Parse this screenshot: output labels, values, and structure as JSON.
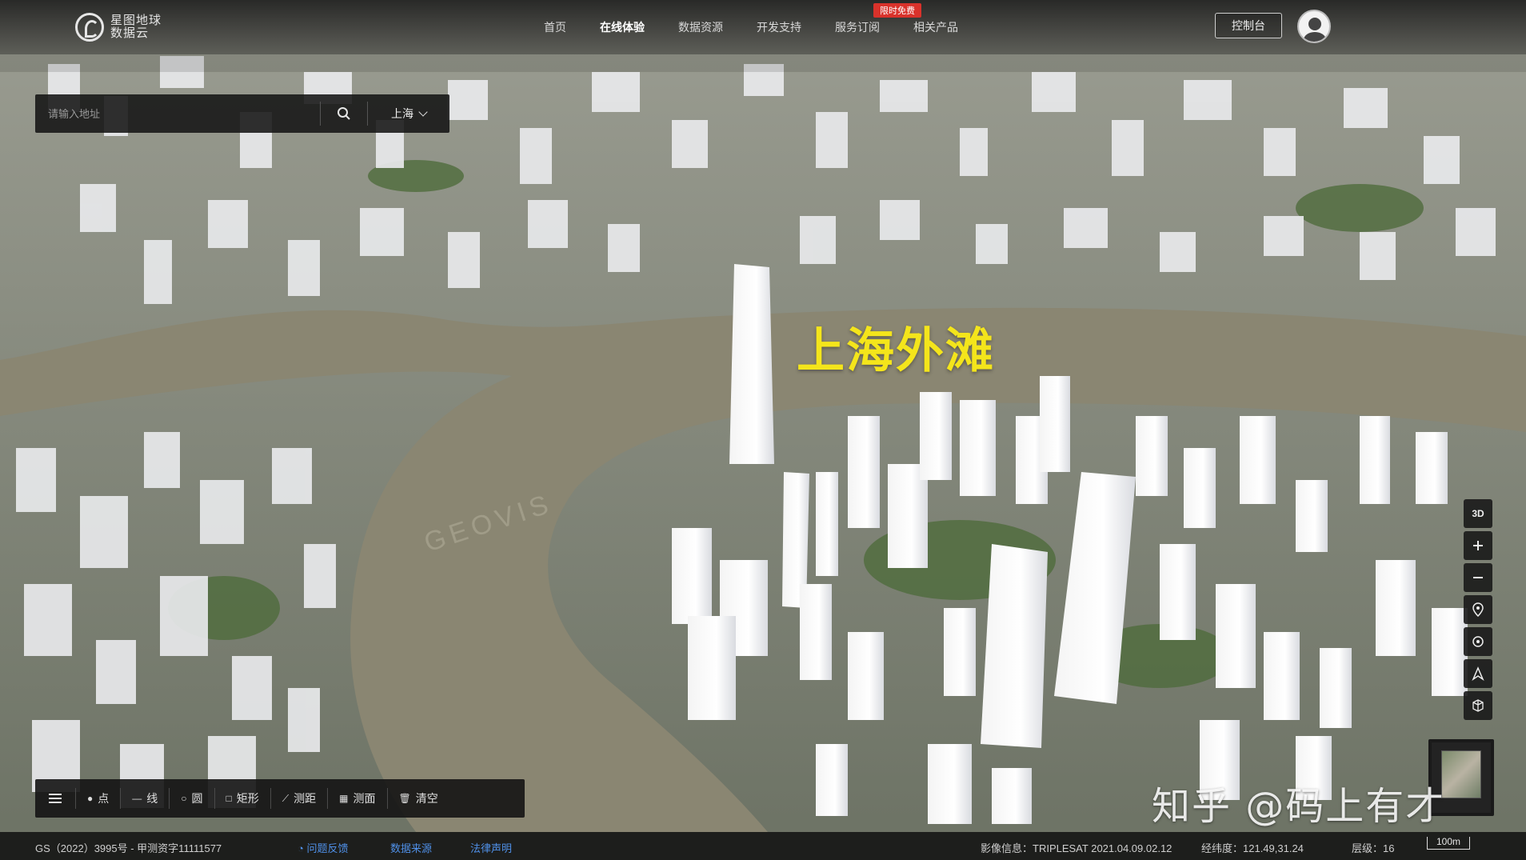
{
  "brand": {
    "line1": "星图地球",
    "line2": "数据云"
  },
  "nav": {
    "items": [
      {
        "label": "首页"
      },
      {
        "label": "在线体验",
        "active": true
      },
      {
        "label": "数据资源"
      },
      {
        "label": "开发支持"
      },
      {
        "label": "服务订阅"
      },
      {
        "label": "相关产品"
      }
    ],
    "promo_badge": "限时免费",
    "console_label": "控制台"
  },
  "search": {
    "placeholder": "请输入地址",
    "city": "上海"
  },
  "map": {
    "landmark_label": "上海外滩",
    "river_watermark": "GEOVIS"
  },
  "map_tools": {
    "mode_label": "3D"
  },
  "draw_toolbar": {
    "items": [
      {
        "label": "点",
        "icon": "point-icon"
      },
      {
        "label": "线",
        "icon": "line-icon"
      },
      {
        "label": "圆",
        "icon": "circle-icon"
      },
      {
        "label": "矩形",
        "icon": "rectangle-icon"
      },
      {
        "label": "测距",
        "icon": "ruler-icon"
      },
      {
        "label": "测面",
        "icon": "area-icon"
      },
      {
        "label": "清空",
        "icon": "trash-icon"
      }
    ]
  },
  "status": {
    "license": "GS（2022）3995号 - 甲测资字11111577",
    "feedback": "问题反馈",
    "data_source": "数据来源",
    "legal": "法律声明",
    "imagery": "影像信息：TRIPLESAT 2021.04.09.02.12",
    "coords": "经纬度：121.49,31.24",
    "level": "层级：16",
    "scale": "100m"
  },
  "watermark": "知乎 @码上有才",
  "colors": {
    "landmark": "#f4e51b",
    "link": "#4f90e8",
    "promo": "#d9322b",
    "river": "#8a8672"
  }
}
